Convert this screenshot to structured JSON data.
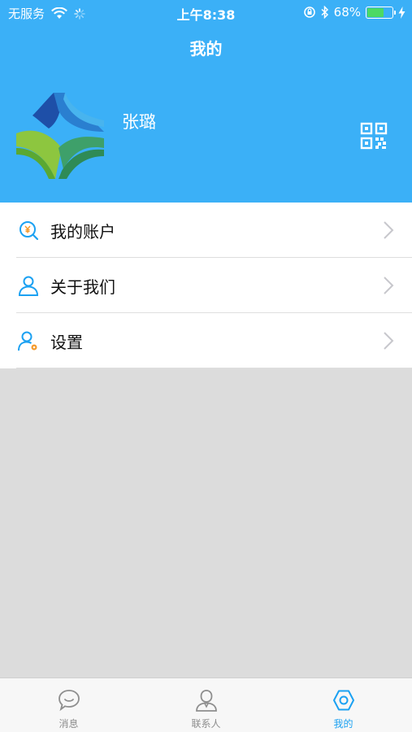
{
  "status_bar": {
    "carrier": "无服务",
    "time": "上午8:38",
    "battery_percent": "68%",
    "battery_level": 0.68
  },
  "header": {
    "title": "我的",
    "user_name": "张璐"
  },
  "menu": {
    "items": [
      {
        "label": "我的账户",
        "icon": "account-coin-icon"
      },
      {
        "label": "关于我们",
        "icon": "person-icon"
      },
      {
        "label": "设置",
        "icon": "person-settings-icon"
      }
    ]
  },
  "tabbar": {
    "tabs": [
      {
        "label": "消息",
        "icon": "chat-bubble-icon",
        "active": false
      },
      {
        "label": "联系人",
        "icon": "contact-icon",
        "active": false
      },
      {
        "label": "我的",
        "icon": "hexagon-settings-icon",
        "active": true
      }
    ]
  },
  "colors": {
    "header_bg": "#3bb0f7",
    "accent": "#1ba1f2",
    "page_bg": "#dcdcdc"
  }
}
